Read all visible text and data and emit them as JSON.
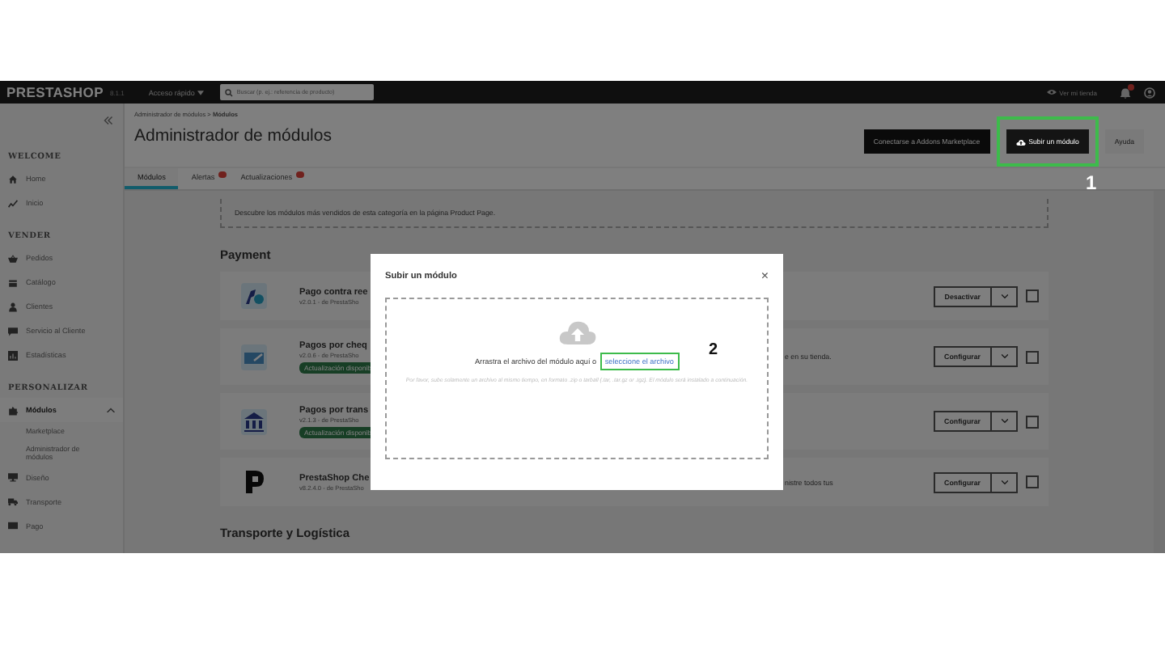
{
  "topbar": {
    "logo": "PRESTASHOP",
    "version": "8.1.1",
    "quick_access": "Acceso rápido",
    "search": {
      "placeholder": "Buscar (p. ej.: referencia de producto)"
    },
    "view_store": "Ver mi tienda"
  },
  "sidebar": {
    "sections": [
      {
        "title": "WELCOME",
        "items": [
          {
            "label": "Home",
            "selected": false,
            "expanded": false
          },
          {
            "label": "Inicio",
            "selected": false,
            "expanded": false
          }
        ]
      },
      {
        "title": "VENDER",
        "items": [
          {
            "label": "Pedidos",
            "selected": false,
            "expanded": false
          },
          {
            "label": "Catálogo",
            "selected": false,
            "expanded": false
          },
          {
            "label": "Clientes",
            "selected": false,
            "expanded": false
          },
          {
            "label": "Servicio al Cliente",
            "selected": false,
            "expanded": false
          },
          {
            "label": "Estadísticas",
            "selected": false,
            "expanded": false
          }
        ]
      },
      {
        "title": "PERSONALIZAR",
        "items": [
          {
            "label": "Módulos",
            "selected": true,
            "expanded": true,
            "children": [
              {
                "label": "Marketplace",
                "selected": false
              },
              {
                "label": "Administrador de módulos",
                "selected": false
              }
            ]
          },
          {
            "label": "Diseño",
            "selected": false,
            "expanded": false
          },
          {
            "label": "Transporte",
            "selected": false,
            "expanded": false
          },
          {
            "label": "Pago",
            "selected": false,
            "expanded": false
          }
        ]
      }
    ]
  },
  "header": {
    "breadcrumb": "Administrador de módulos > **Módulos**",
    "title": "Administrador de módulos",
    "buttons": [
      {
        "label": "Conectarse a Addons Marketplace",
        "kind": "dark"
      },
      {
        "label": "Subir un módulo",
        "kind": "upload"
      },
      {
        "label": "Ayuda",
        "kind": "light"
      }
    ]
  },
  "tabs": [
    {
      "label": "Módulos",
      "selected": true,
      "badge": false
    },
    {
      "label": "Alertas",
      "selected": false,
      "badge": true
    },
    {
      "label": "Actualizaciones",
      "selected": false,
      "badge": true
    }
  ],
  "content": {
    "promo": "Descubre los módulos más vendidos de esta categoría en la página Product Page.",
    "section_title": "Payment",
    "modules": [
      {
        "name": "Pago contra ree",
        "version": "v2.0.1 - de PrestaSho",
        "update": false,
        "action": "Desactivar",
        "checked": false
      },
      {
        "name": "Pagos por cheq",
        "version": "v2.0.6 - de PrestaSho",
        "update": true,
        "update_label": "Actualización disponib",
        "description": "e en su tienda.",
        "action": "Configurar",
        "checked": false
      },
      {
        "name": "Pagos por trans",
        "version": "v2.1.3 - de PrestaSho",
        "update": true,
        "update_label": "Actualización disponib",
        "action": "Configurar",
        "checked": false
      },
      {
        "name": "PrestaShop Che",
        "version": "v8.2.4.0 - de PrestaSho",
        "update": false,
        "description": "nistre todos tus",
        "action": "Configurar",
        "checked": false
      }
    ],
    "next_section": "Transporte y Logística"
  },
  "modal": {
    "title": "Subir un módulo",
    "close": "×",
    "drop_text": "Arrastra el archivo del módulo aquí o",
    "link": "seleccione el archivo",
    "hint": "Por favor, sube solamente un archivo al mismo tiempo, en formato .zip o tarball (.tar, .tar.gz or .tgz). El módulo será instalado a continuación."
  },
  "annotations": [
    "1",
    "2"
  ]
}
